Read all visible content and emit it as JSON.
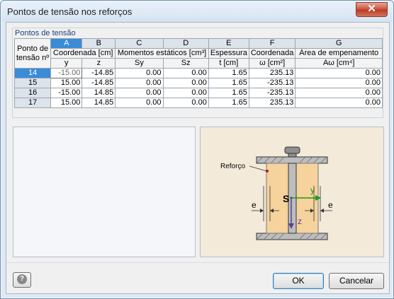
{
  "window": {
    "title": "Pontos de tensão nos reforços",
    "close_label": "✕"
  },
  "group": {
    "title": "Pontos de tensão"
  },
  "table": {
    "col_letters": [
      "A",
      "B",
      "C",
      "D",
      "E",
      "F",
      "G"
    ],
    "row_header_title": [
      "Ponto de",
      "tensão nº"
    ],
    "group_headers": {
      "coord": "Coordenada [cm]",
      "momentos": "Momentos estáticos [cm³]",
      "espessura": "Espessura",
      "coordenada": "Coordenada",
      "area": "Área de empenamento"
    },
    "sub_headers": [
      "y",
      "z",
      "Sy",
      "Sz",
      "t [cm]",
      "ω [cm²]",
      "Aω [cm⁴]"
    ],
    "rows": [
      {
        "no": "14",
        "y": "-15.00",
        "z": "-14.85",
        "sy": "0.00",
        "sz": "0.00",
        "t": "1.65",
        "w": "235.13",
        "a": "0.00"
      },
      {
        "no": "15",
        "y": "15.00",
        "z": "-14.85",
        "sy": "0.00",
        "sz": "0.00",
        "t": "1.65",
        "w": "-235.13",
        "a": "0.00"
      },
      {
        "no": "16",
        "y": "-15.00",
        "z": "14.85",
        "sy": "0.00",
        "sz": "0.00",
        "t": "1.65",
        "w": "-235.13",
        "a": "0.00"
      },
      {
        "no": "17",
        "y": "15.00",
        "z": "14.85",
        "sy": "0.00",
        "sz": "0.00",
        "t": "1.65",
        "w": "235.13",
        "a": "0.00"
      }
    ]
  },
  "diagram": {
    "reforco": "Reforço",
    "s": "S",
    "y": "y",
    "z": "z",
    "e_left": "e",
    "e_right": "e"
  },
  "buttons": {
    "ok": "OK",
    "cancel": "Cancelar",
    "help_glyph": "?"
  }
}
